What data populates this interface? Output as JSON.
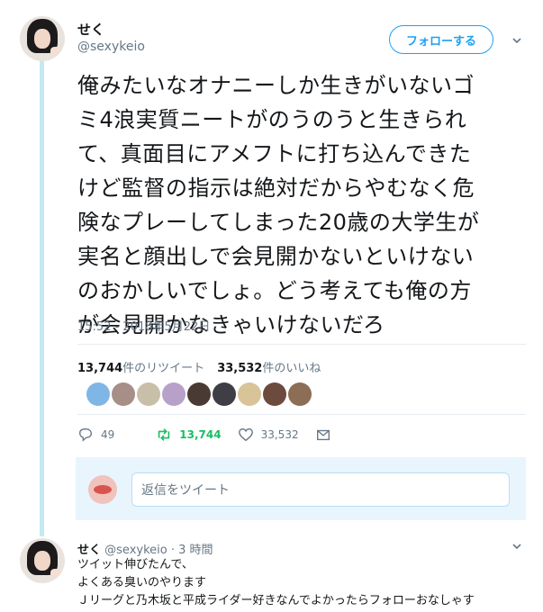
{
  "tweet": {
    "author_name": "せく",
    "author_handle": "@sexykeio",
    "follow_label": "フォローする",
    "text": "俺みたいなオナニーしか生きがいないゴ\nミ4浪実質ニートがのうのうと生きられ\nて、真面目にアメフトに打ち込んできた\nけど監督の指示は絶対だからやむなく危\n険なプレーしてしまった20歳の大学生が\n実名と顔出しで会見開かないといけない\nのおかしいでしょ。どう考えても俺の方\nが会見開かなきゃいけないだろ",
    "timestamp": "15:52 - 2018年5月22日",
    "retweet_count": "13,744",
    "retweet_suffix": "件のリツイート",
    "like_count": "33,532",
    "like_suffix": "件のいいね",
    "actions": {
      "reply_count": "49",
      "retweet_count": "13,744",
      "like_count": "33,532"
    },
    "reply_placeholder": "返信をツイート"
  },
  "likers": [
    {
      "icon": "liker-avatar-1",
      "color": "#7fb6e6"
    },
    {
      "icon": "liker-avatar-2",
      "color": "#a78e86"
    },
    {
      "icon": "liker-avatar-3",
      "color": "#c8bfa8"
    },
    {
      "icon": "liker-avatar-4",
      "color": "#b7a1c8"
    },
    {
      "icon": "liker-avatar-5",
      "color": "#4a3a34"
    },
    {
      "icon": "liker-avatar-6",
      "color": "#3e3e44"
    },
    {
      "icon": "liker-avatar-7",
      "color": "#d9c49a"
    },
    {
      "icon": "liker-avatar-8",
      "color": "#6d4a3e"
    },
    {
      "icon": "liker-avatar-9",
      "color": "#8c6d55"
    }
  ],
  "reply": {
    "author_name": "せく",
    "author_handle": "@sexykeio",
    "separator": "·",
    "time": "3 時間",
    "text": "ツイット伸びたんで、\nよくある臭いのやります\nＪリーグと乃木坂と平成ライダー好きなんでよかったらフォローおなしゃす"
  },
  "colors": {
    "accent": "#1da1f2",
    "retweet": "#17bf63",
    "muted": "#657786",
    "thread_line": "#c4e9f5"
  }
}
